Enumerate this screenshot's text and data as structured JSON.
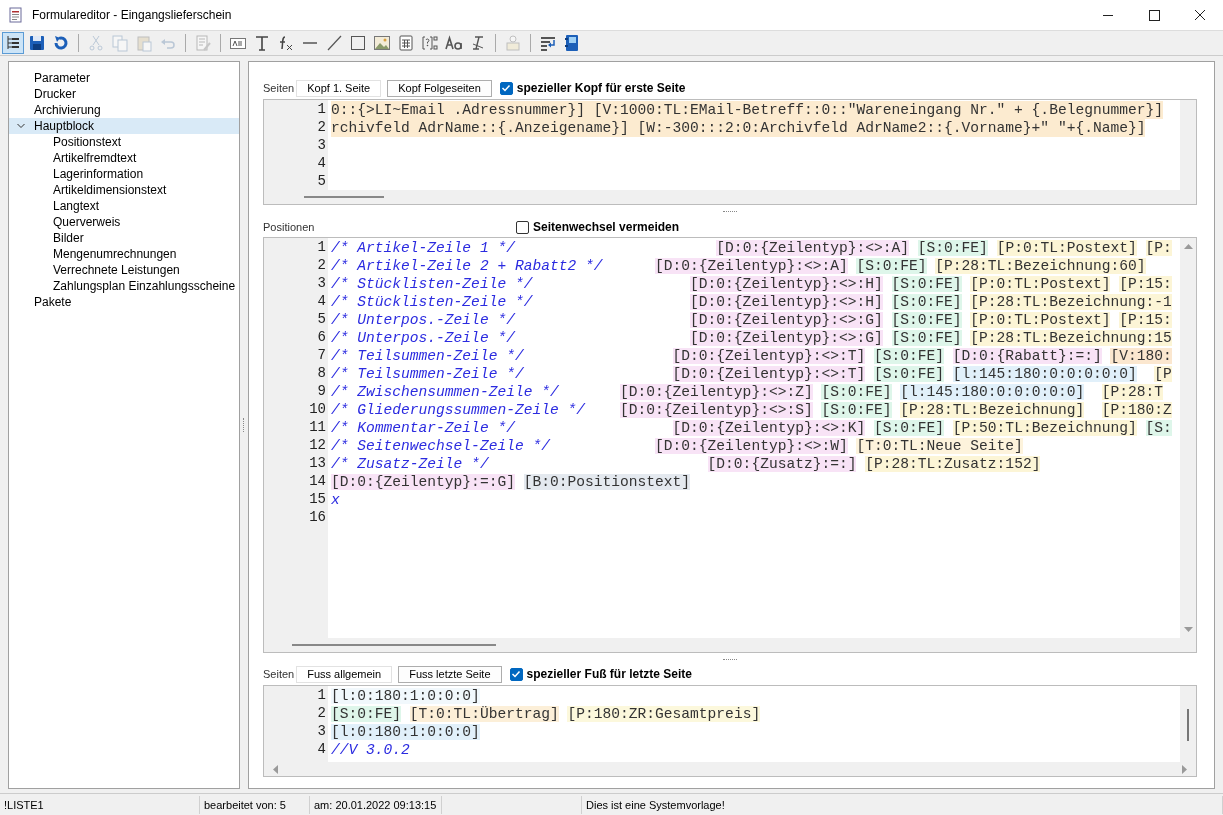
{
  "window": {
    "title": "Formulareditor - Eingangslieferschein"
  },
  "toolbar": [
    [
      {
        "selected": true,
        "disabled": false
      },
      {
        "selected": false,
        "disabled": false
      },
      {
        "selected": false,
        "disabled": false
      }
    ],
    [
      {
        "selected": false,
        "disabled": true
      },
      {
        "selected": false,
        "disabled": true
      },
      {
        "selected": false,
        "disabled": true
      },
      {
        "selected": false,
        "disabled": true
      }
    ],
    [
      {
        "selected": false,
        "disabled": true
      }
    ],
    [
      {
        "selected": false,
        "disabled": false
      },
      {
        "selected": false,
        "disabled": false
      },
      {
        "selected": false,
        "disabled": false
      },
      {
        "selected": false,
        "disabled": false
      },
      {
        "selected": false,
        "disabled": false
      },
      {
        "selected": false,
        "disabled": false
      },
      {
        "selected": false,
        "disabled": false
      },
      {
        "selected": false,
        "disabled": false
      },
      {
        "selected": false,
        "disabled": false
      },
      {
        "selected": false,
        "disabled": false
      },
      {
        "selected": false,
        "disabled": false
      }
    ],
    [
      {
        "selected": false,
        "disabled": true
      }
    ],
    [
      {
        "selected": false,
        "disabled": false
      },
      {
        "selected": false,
        "disabled": false
      }
    ]
  ],
  "sidebar": {
    "items": [
      {
        "label": "Parameter",
        "selected": false
      },
      {
        "label": "Drucker",
        "selected": false
      },
      {
        "label": "Archivierung",
        "selected": false
      },
      {
        "label": "Hauptblock",
        "selected": true,
        "expanded": true,
        "children": [
          {
            "label": "Positionstext",
            "selected": false
          },
          {
            "label": "Artikelfremdtext",
            "selected": false
          },
          {
            "label": "Lagerinformation",
            "selected": false
          },
          {
            "label": "Artikeldimensionstext",
            "selected": false
          },
          {
            "label": "Langtext",
            "selected": false
          },
          {
            "label": "Querverweis",
            "selected": false
          },
          {
            "label": "Bilder",
            "selected": false
          },
          {
            "label": "Mengenumrechnungen",
            "selected": false
          },
          {
            "label": "Verrechnete Leistungen",
            "selected": false
          },
          {
            "label": "Zahlungsplan Einzahlungsscheine",
            "selected": false
          }
        ]
      },
      {
        "label": "Pakete",
        "selected": false
      }
    ]
  },
  "header": {
    "label": "Seiten",
    "tabs": [
      {
        "label": "Kopf 1. Seite",
        "selected": true
      },
      {
        "label": "Kopf Folgeseiten",
        "selected": false
      }
    ],
    "option": {
      "label": "spezieller Kopf für erste Seite",
      "checked": true
    },
    "editor": {
      "lines": [
        {
          "number": "1",
          "color": "#fcebd0",
          "segments": [
            {
              "kind": "code",
              "text": "0::{>LI~Email .Adressnummer}] [V:1000:TL:EMail-Betreff::0::\"Wareneingang Nr.\" + {.Belegnummer}]"
            }
          ]
        },
        {
          "number": "2",
          "color": "#fcebd0",
          "segments": [
            {
              "kind": "code",
              "text": "rchivfeld AdrName::{.Anzeigename}] [W:-300:::2:0:Archivfeld AdrName2::{.Vorname}+\" \"+{.Name}]"
            }
          ]
        },
        {
          "number": "3"
        },
        {
          "number": "4"
        },
        {
          "number": "5"
        }
      ]
    }
  },
  "positions": {
    "label": "Positionen",
    "option": {
      "label": "Seitenwechsel vermeiden",
      "checked": false
    },
    "editor": {
      "lines": [
        {
          "number": "1",
          "segments": [
            {
              "kind": "comment",
              "text": "/* Artikel-Zeile 1 */"
            },
            {
              "kind": "code",
              "text": "                       [D:0:{Zeilentyp}:<>:A]",
              "color": "#f8e3f6"
            },
            {
              "kind": "code",
              "text": " [S:0:FE]",
              "color": "#def6ea"
            },
            {
              "kind": "code",
              "text": " [P:0:TL:Postext]",
              "color": "#fcf5d6"
            },
            {
              "kind": "code",
              "text": " [P:",
              "color": "#fcf5d6"
            }
          ]
        },
        {
          "number": "2",
          "segments": [
            {
              "kind": "comment",
              "text": "/* Artikel-Zeile 2 + Rabatt2 */"
            },
            {
              "kind": "code",
              "text": "      [D:0:{Zeilentyp}:<>:A]",
              "color": "#f8e3f6"
            },
            {
              "kind": "code",
              "text": " [S:0:FE]",
              "color": "#def6ea"
            },
            {
              "kind": "code",
              "text": " [P:28:TL:Bezeichnung:60]",
              "color": "#fcf5d6"
            }
          ]
        },
        {
          "number": "3",
          "segments": [
            {
              "kind": "comment",
              "text": "/* Stücklisten-Zeile */"
            },
            {
              "kind": "code",
              "text": "                  [D:0:{Zeilentyp}:<>:H]",
              "color": "#f8e3f6"
            },
            {
              "kind": "code",
              "text": " [S:0:FE]",
              "color": "#def6ea"
            },
            {
              "kind": "code",
              "text": " [P:0:TL:Postext]",
              "color": "#fcf5d6"
            },
            {
              "kind": "code",
              "text": " [P:15:",
              "color": "#fcf5d6"
            }
          ]
        },
        {
          "number": "4",
          "segments": [
            {
              "kind": "comment",
              "text": "/* Stücklisten-Zeile */"
            },
            {
              "kind": "code",
              "text": "                  [D:0:{Zeilentyp}:<>:H]",
              "color": "#f8e3f6"
            },
            {
              "kind": "code",
              "text": " [S:0:FE]",
              "color": "#def6ea"
            },
            {
              "kind": "code",
              "text": " [P:28:TL:Bezeichnung:-1",
              "color": "#fcf5d6"
            }
          ]
        },
        {
          "number": "5",
          "segments": [
            {
              "kind": "comment",
              "text": "/* Unterpos.-Zeile */"
            },
            {
              "kind": "code",
              "text": "                    [D:0:{Zeilentyp}:<>:G]",
              "color": "#f8e3f6"
            },
            {
              "kind": "code",
              "text": " [S:0:FE]",
              "color": "#def6ea"
            },
            {
              "kind": "code",
              "text": " [P:0:TL:Postext]",
              "color": "#fcf5d6"
            },
            {
              "kind": "code",
              "text": " [P:15:",
              "color": "#fcf5d6"
            }
          ]
        },
        {
          "number": "6",
          "segments": [
            {
              "kind": "comment",
              "text": "/* Unterpos.-Zeile */"
            },
            {
              "kind": "code",
              "text": "                    [D:0:{Zeilentyp}:<>:G]",
              "color": "#f8e3f6"
            },
            {
              "kind": "code",
              "text": " [S:0:FE]",
              "color": "#def6ea"
            },
            {
              "kind": "code",
              "text": " [P:28:TL:Bezeichnung:15",
              "color": "#fcf5d6"
            }
          ]
        },
        {
          "number": "7",
          "segments": [
            {
              "kind": "comment",
              "text": "/* Teilsummen-Zeile */"
            },
            {
              "kind": "code",
              "text": "                 [D:0:{Zeilentyp}:<>:T]",
              "color": "#f8e3f6"
            },
            {
              "kind": "code",
              "text": " [S:0:FE]",
              "color": "#def6ea"
            },
            {
              "kind": "code",
              "text": " [D:0:{Rabatt}:=:]",
              "color": "#f8e3f6"
            },
            {
              "kind": "code",
              "text": " [V:180:",
              "color": "#fbe7cf"
            }
          ]
        },
        {
          "number": "8",
          "segments": [
            {
              "kind": "comment",
              "text": "/* Teilsummen-Zeile */"
            },
            {
              "kind": "code",
              "text": "                 [D:0:{Zeilentyp}:<>:T]",
              "color": "#f8e3f6"
            },
            {
              "kind": "code",
              "text": " [S:0:FE]",
              "color": "#def6ea"
            },
            {
              "kind": "code",
              "text": " [l:145:180:0:0:0:0:0]",
              "color": "#e1f0fa"
            },
            {
              "kind": "code",
              "text": "  [P",
              "color": "#fcf5d6"
            }
          ]
        },
        {
          "number": "9",
          "segments": [
            {
              "kind": "comment",
              "text": "/* Zwischensummen-Zeile */"
            },
            {
              "kind": "code",
              "text": "       [D:0:{Zeilentyp}:<>:Z]",
              "color": "#f8e3f6"
            },
            {
              "kind": "code",
              "text": " [S:0:FE]",
              "color": "#def6ea"
            },
            {
              "kind": "code",
              "text": " [l:145:180:0:0:0:0:0]",
              "color": "#e1f0fa"
            },
            {
              "kind": "code",
              "text": "  [P:28:T",
              "color": "#fcf5d6"
            }
          ]
        },
        {
          "number": "10",
          "segments": [
            {
              "kind": "comment",
              "text": "/* Gliederungssummen-Zeile */"
            },
            {
              "kind": "code",
              "text": "    [D:0:{Zeilentyp}:<>:S]",
              "color": "#f8e3f6"
            },
            {
              "kind": "code",
              "text": " [S:0:FE]",
              "color": "#def6ea"
            },
            {
              "kind": "code",
              "text": " [P:28:TL:Bezeichnung]",
              "color": "#fcf5d6"
            },
            {
              "kind": "code",
              "text": "  [P:180:Z",
              "color": "#fcf5d6"
            }
          ]
        },
        {
          "number": "11",
          "segments": [
            {
              "kind": "comment",
              "text": "/* Kommentar-Zeile */"
            },
            {
              "kind": "code",
              "text": "                  [D:0:{Zeilentyp}:<>:K]",
              "color": "#f8e3f6"
            },
            {
              "kind": "code",
              "text": " [S:0:FE]",
              "color": "#def6ea"
            },
            {
              "kind": "code",
              "text": " [P:50:TL:Bezeichnung]",
              "color": "#fcf5d6"
            },
            {
              "kind": "code",
              "text": " [S:",
              "color": "#def6ea"
            }
          ]
        },
        {
          "number": "12",
          "segments": [
            {
              "kind": "comment",
              "text": "/* Seitenwechsel-Zeile */"
            },
            {
              "kind": "code",
              "text": "            [D:0:{Zeilentyp}:<>:W]",
              "color": "#f8e3f6"
            },
            {
              "kind": "code",
              "text": " [T:0:TL:Neue Seite]",
              "color": "#fdf3dc"
            }
          ]
        },
        {
          "number": "13",
          "segments": [
            {
              "kind": "comment",
              "text": "/* Zusatz-Zeile */"
            },
            {
              "kind": "code",
              "text": "                         [D:0:{Zusatz}:=:]",
              "color": "#f8e3f6"
            },
            {
              "kind": "code",
              "text": " [P:28:TL:Zusatz:152]",
              "color": "#fcf5d6"
            }
          ]
        },
        {
          "number": "14",
          "segments": [
            {
              "kind": "code",
              "text": "[D:0:{Zeilentyp}:=:G]",
              "color": "#f8e3f6"
            },
            {
              "kind": "code",
              "text": " [B:0:Positionstext]",
              "color": "#e4e9ef"
            }
          ]
        },
        {
          "number": "15",
          "segments": [
            {
              "kind": "comment",
              "text": "x"
            }
          ]
        },
        {
          "number": "16"
        }
      ]
    }
  },
  "footer": {
    "label": "Seiten",
    "tabs": [
      {
        "label": "Fuss allgemein",
        "selected": true
      },
      {
        "label": "Fuss letzte Seite",
        "selected": false
      }
    ],
    "option": {
      "label": "spezieller Fuß für letzte Seite",
      "checked": true
    },
    "editor": {
      "lines": [
        {
          "number": "1",
          "segments": [
            {
              "kind": "code",
              "text": "[l:0:180:1:0:0:0]",
              "color": "#f1f8fc"
            }
          ]
        },
        {
          "number": "2",
          "segments": [
            {
              "kind": "code",
              "text": "[S:0:FE]",
              "color": "#def6ea"
            },
            {
              "kind": "code",
              "text": " [T:0:TL:Übertrag]",
              "color": "#fcefd8"
            },
            {
              "kind": "code",
              "text": " [P:180:ZR:Gesamtpreis]",
              "color": "#fcf8dc"
            }
          ]
        },
        {
          "number": "3",
          "segments": [
            {
              "kind": "code",
              "text": "[l:0:180:1:0:0:0]",
              "color": "#e1f0fa"
            }
          ]
        },
        {
          "number": "4",
          "segments": [
            {
              "kind": "comment",
              "text": "//V 3.0.2"
            }
          ]
        }
      ]
    }
  },
  "status_bar": [
    "!LISTE1",
    "bearbeitet von:  5",
    "am: 20.01.2022 09:13:15",
    "Dies ist eine Systemvorlage!"
  ]
}
